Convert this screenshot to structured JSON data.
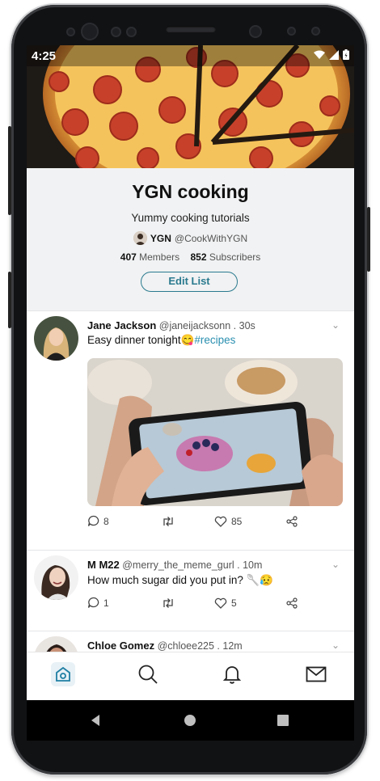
{
  "status_bar": {
    "time": "4:25"
  },
  "list_header": {
    "title": "YGN cooking",
    "subtitle": "Yummy cooking tutorials",
    "owner_name": "YGN",
    "owner_handle": "@CookWithYGN",
    "members_count": "407",
    "members_label": "Members",
    "subscribers_count": "852",
    "subscribers_label": "Subscribers",
    "edit_button_label": "Edit List"
  },
  "tweets": [
    {
      "name": "Jane Jackson",
      "handle_time": "@janeijacksonn . 30s",
      "text": "Easy dinner tonight😋",
      "hashtag": "#recipes",
      "replies": "8",
      "likes": "85"
    },
    {
      "name": "M M22",
      "handle_time": "@merry_the_meme_gurl . 10m",
      "text": "How much sugar did you put in? 🥄😥",
      "replies": "1",
      "likes": "5"
    },
    {
      "name": "Chloe Gomez",
      "handle_time": "@chloee225 . 12m"
    }
  ],
  "bottom_nav": [
    "home-icon",
    "search-icon",
    "bell-icon",
    "mail-icon"
  ],
  "colors": {
    "accent": "#2a7a8f",
    "hashtag": "#2a8fb0",
    "header_bg": "#f1f2f3"
  }
}
